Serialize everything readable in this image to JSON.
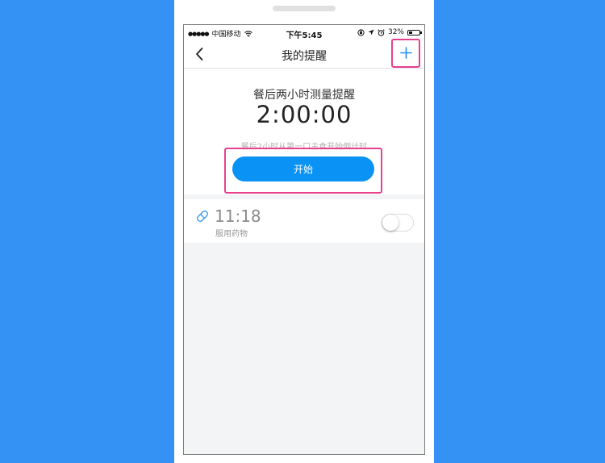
{
  "status_bar": {
    "signal": "●●●●●",
    "carrier": "中国移动",
    "time": "下午5:45",
    "battery_text": "32%",
    "battery_level": 0.32
  },
  "nav": {
    "title": "我的提醒"
  },
  "timer": {
    "title": "餐后两小时测量提醒",
    "countdown": "2:00:00",
    "hint": "餐后2小时从第一口主食开始倒计时",
    "start_label": "开始"
  },
  "reminder": {
    "time": "11:18",
    "label": "服用药物",
    "enabled": false
  },
  "colors": {
    "background": "#3592f5",
    "accent": "#0a93f5",
    "highlight": "#e8408d"
  }
}
